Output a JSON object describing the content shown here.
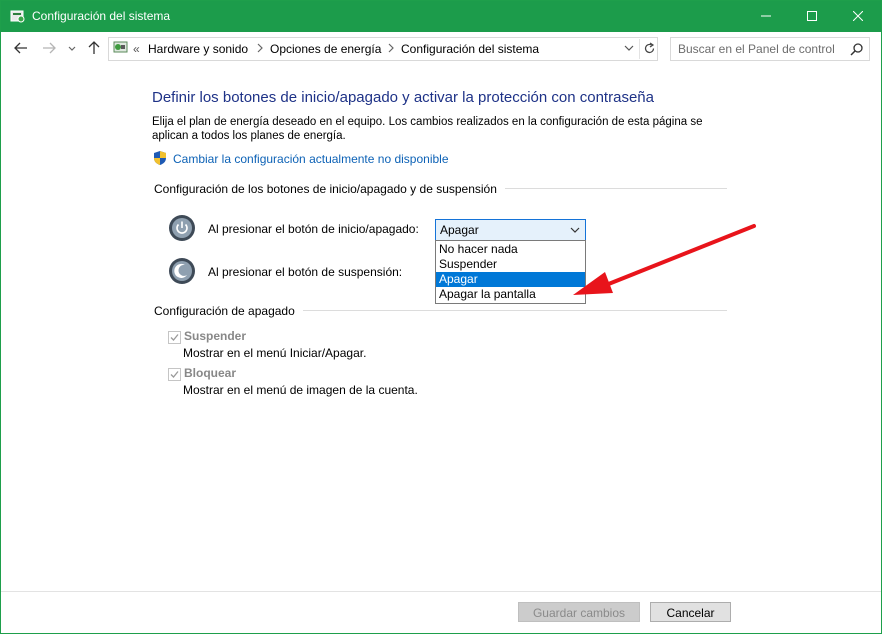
{
  "window": {
    "title": "Configuración del sistema"
  },
  "breadcrumb": {
    "prefix": "«",
    "items": [
      "Hardware y sonido",
      "Opciones de energía",
      "Configuración del sistema"
    ]
  },
  "search": {
    "placeholder": "Buscar en el Panel de control"
  },
  "page": {
    "heading": "Definir los botones de inicio/apagado y activar la protección con contraseña",
    "intro": "Elija el plan de energía deseado en el equipo. Los cambios realizados en la configuración de esta página se aplican a todos los planes de energía.",
    "change_link": "Cambiar la configuración actualmente no disponible"
  },
  "buttons_section": {
    "title": "Configuración de los botones de inicio/apagado y de suspensión",
    "power_label": "Al presionar el botón de inicio/apagado:",
    "power_value": "Apagar",
    "sleep_label": "Al presionar el botón de suspensión:",
    "dropdown_options": [
      "No hacer nada",
      "Suspender",
      "Apagar",
      "Apagar la pantalla"
    ],
    "selected_index": 2
  },
  "shutdown_section": {
    "title": "Configuración de apagado",
    "items": [
      {
        "label": "Suspender",
        "desc": "Mostrar en el menú Iniciar/Apagar.",
        "checked": true,
        "enabled": false
      },
      {
        "label": "Bloquear",
        "desc": "Mostrar en el menú de imagen de la cuenta.",
        "checked": true,
        "enabled": false
      }
    ]
  },
  "footer": {
    "save_label": "Guardar cambios",
    "cancel_label": "Cancelar"
  },
  "colors": {
    "titlebar": "#1c9c4b",
    "heading": "#1e3287",
    "link": "#0d62b6",
    "selection": "#0078d7",
    "annotation_arrow": "#e8141b"
  }
}
